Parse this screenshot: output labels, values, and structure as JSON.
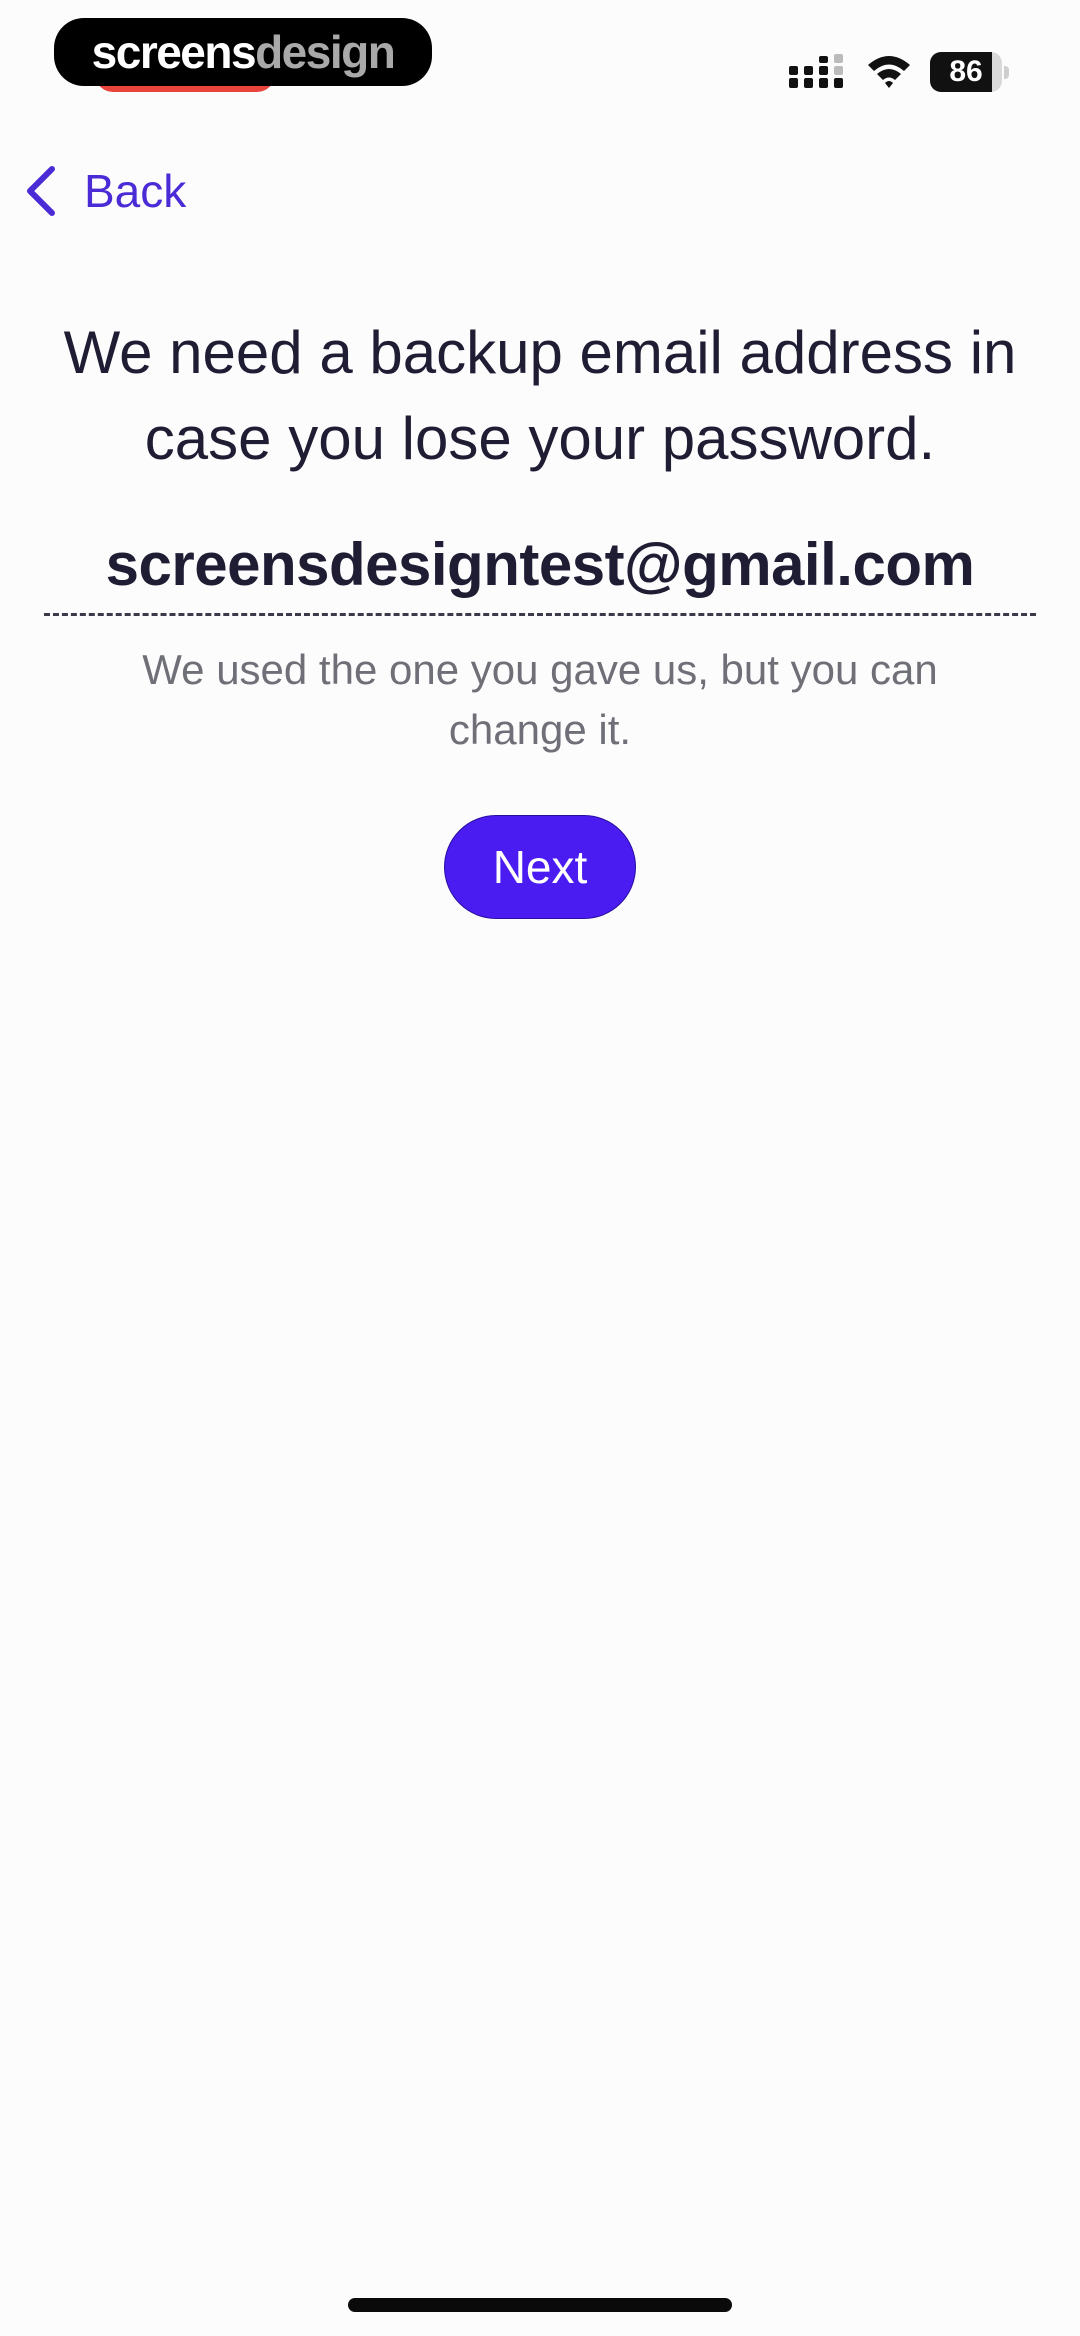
{
  "status_bar": {
    "watermark_part1": "screens",
    "watermark_part2": "design",
    "battery_level": "86",
    "battery_fraction": 0.86,
    "recording_indicator_color": "#e8443b",
    "icons": [
      "cellular-signal-icon",
      "wifi-icon",
      "battery-icon"
    ]
  },
  "nav": {
    "back_label": "Back",
    "back_icon": "chevron-left-icon",
    "accent_color": "#4b2bd6"
  },
  "main": {
    "headline": "We need a backup email address in case you lose your password.",
    "email_value": "screensdesigntest@gmail.com",
    "helper_text": "We used the one you gave us, but you can change it.",
    "next_label": "Next",
    "button_color": "#4a1cf2"
  }
}
